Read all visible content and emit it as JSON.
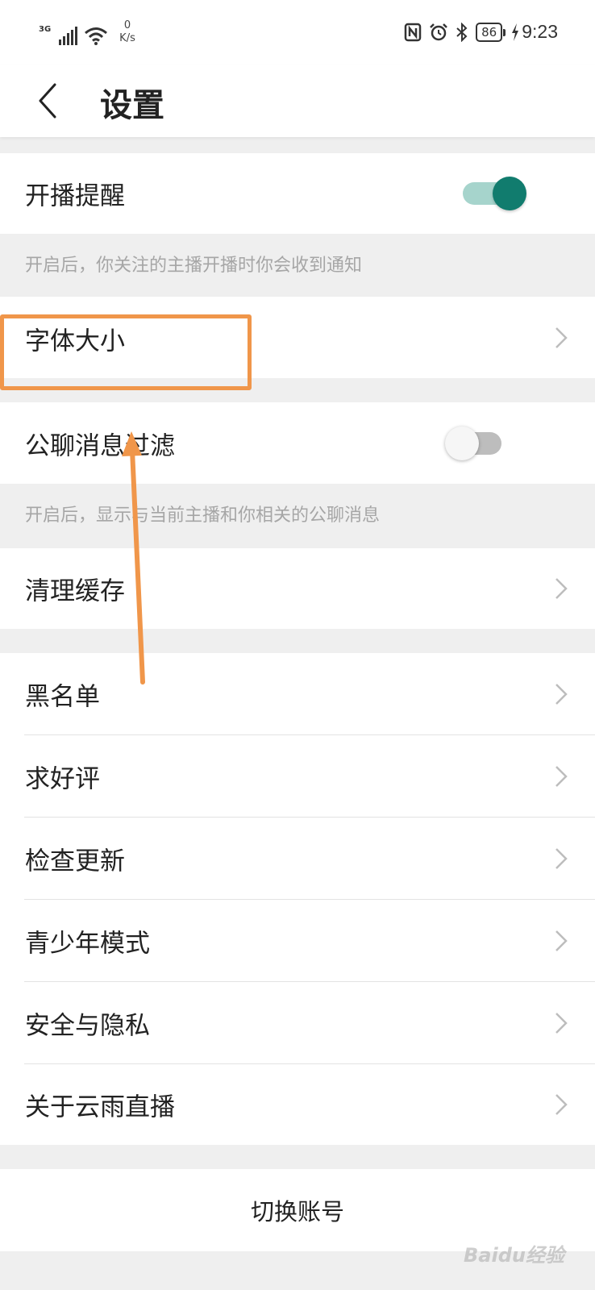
{
  "status_bar": {
    "network_type": "3G",
    "speed_value": "0",
    "speed_unit": "K/s",
    "battery": "86",
    "time": "9:23",
    "icons": [
      "signal-icon",
      "wifi-icon",
      "nfc-icon",
      "alarm-icon",
      "bluetooth-icon",
      "battery-icon",
      "charging-icon"
    ]
  },
  "header": {
    "title": "设置",
    "back_icon": "chevron-left-icon"
  },
  "settings": {
    "live_reminder": {
      "label": "开播提醒",
      "enabled": true,
      "hint": "开启后，你关注的主播开播时你会收到通知"
    },
    "font_size": {
      "label": "字体大小"
    },
    "chat_filter": {
      "label": "公聊消息过滤",
      "enabled": false,
      "hint": "开启后，显示与当前主播和你相关的公聊消息"
    },
    "clear_cache": {
      "label": "清理缓存"
    },
    "list": [
      {
        "label": "黑名单"
      },
      {
        "label": "求好评"
      },
      {
        "label": "检查更新"
      },
      {
        "label": "青少年模式"
      },
      {
        "label": "安全与隐私"
      },
      {
        "label": "关于云雨直播"
      }
    ]
  },
  "switch_account": {
    "label": "切换账号"
  },
  "watermark": "Baidu经验",
  "colors": {
    "toggle_on": "#117c6e",
    "toggle_on_track": "#a6d4cc",
    "annotation": "#f0964a",
    "background": "#efefef"
  }
}
